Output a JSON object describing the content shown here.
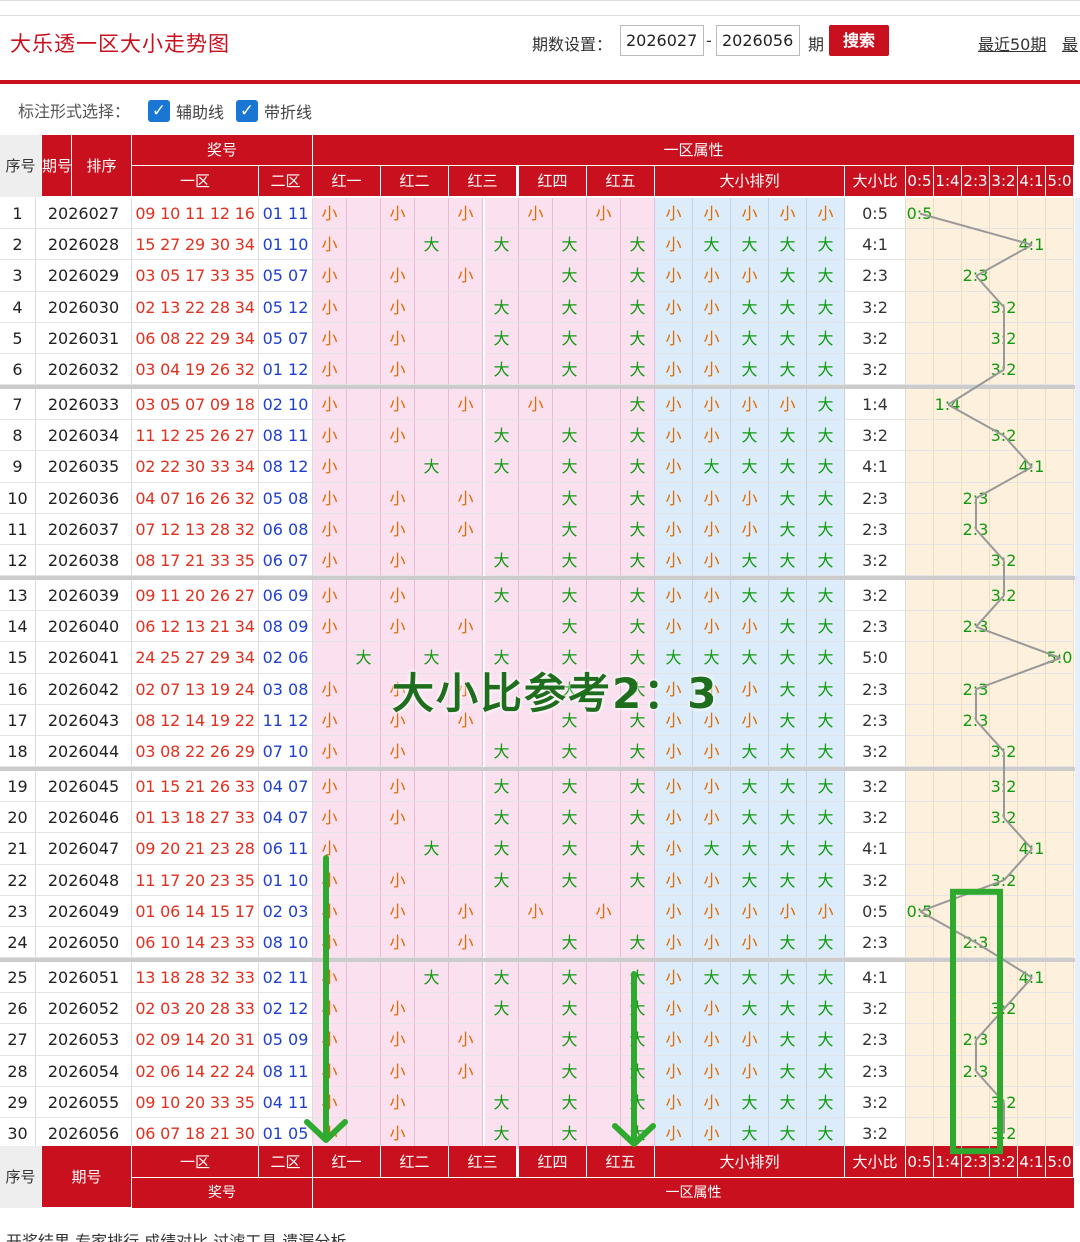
{
  "title": "大乐透一区大小走势图",
  "controls": {
    "label": "期数设置：",
    "start": "2026027",
    "sep": "-",
    "end": "2026056",
    "qi": "期",
    "search": "搜索",
    "recent50": "最近50期",
    "recent_more": "最"
  },
  "options": {
    "label": "标注形式选择：",
    "aux": "辅助线",
    "line": "带折线",
    "aux_checked": true,
    "line_checked": true
  },
  "headers": {
    "seq": "序号",
    "qihao": "期号",
    "sort": "排序",
    "jianghao": "奖号",
    "yiqu": "一区",
    "erqu": "二区",
    "attr": "一区属性",
    "reds": [
      "红一",
      "红二",
      "红三",
      "红四",
      "红五"
    ],
    "arr": "大小排列",
    "ratio": "大小比",
    "ratios": [
      "0:5",
      "1:4",
      "2:3",
      "3:2",
      "4:1",
      "5:0"
    ]
  },
  "rows": [
    {
      "n": "1",
      "q": "2026027",
      "red": "09 10 11 12 16",
      "blue": "01 11",
      "p": "SSSSS",
      "r": "0:5"
    },
    {
      "n": "2",
      "q": "2026028",
      "red": "15 27 29 30 34",
      "blue": "01 10",
      "p": "SBBBB",
      "r": "4:1"
    },
    {
      "n": "3",
      "q": "2026029",
      "red": "03 05 17 33 35",
      "blue": "05 07",
      "p": "SSSBB",
      "r": "2:3"
    },
    {
      "n": "4",
      "q": "2026030",
      "red": "02 13 22 28 34",
      "blue": "05 12",
      "p": "SSBBB",
      "r": "3:2"
    },
    {
      "n": "5",
      "q": "2026031",
      "red": "06 08 22 29 34",
      "blue": "05 07",
      "p": "SSBBB",
      "r": "3:2"
    },
    {
      "n": "6",
      "q": "2026032",
      "red": "03 04 19 26 32",
      "blue": "01 12",
      "p": "SSBBB",
      "r": "3:2"
    },
    {
      "n": "7",
      "q": "2026033",
      "red": "03 05 07 09 18",
      "blue": "02 10",
      "p": "SSSSB",
      "r": "1:4"
    },
    {
      "n": "8",
      "q": "2026034",
      "red": "11 12 25 26 27",
      "blue": "08 11",
      "p": "SSBBB",
      "r": "3:2"
    },
    {
      "n": "9",
      "q": "2026035",
      "red": "02 22 30 33 34",
      "blue": "08 12",
      "p": "SBBBB",
      "r": "4:1"
    },
    {
      "n": "10",
      "q": "2026036",
      "red": "04 07 16 26 32",
      "blue": "05 08",
      "p": "SSSBB",
      "r": "2:3"
    },
    {
      "n": "11",
      "q": "2026037",
      "red": "07 12 13 28 32",
      "blue": "06 08",
      "p": "SSSBB",
      "r": "2:3"
    },
    {
      "n": "12",
      "q": "2026038",
      "red": "08 17 21 33 35",
      "blue": "06 07",
      "p": "SSBBB",
      "r": "3:2"
    },
    {
      "n": "13",
      "q": "2026039",
      "red": "09 11 20 26 27",
      "blue": "06 09",
      "p": "SSBBB",
      "r": "3:2"
    },
    {
      "n": "14",
      "q": "2026040",
      "red": "06 12 13 21 34",
      "blue": "08 09",
      "p": "SSSBB",
      "r": "2:3"
    },
    {
      "n": "15",
      "q": "2026041",
      "red": "24 25 27 29 34",
      "blue": "02 06",
      "p": "BBBBB",
      "r": "5:0"
    },
    {
      "n": "16",
      "q": "2026042",
      "red": "02 07 13 19 24",
      "blue": "03 08",
      "p": "SSSBB",
      "r": "2:3"
    },
    {
      "n": "17",
      "q": "2026043",
      "red": "08 12 14 19 22",
      "blue": "11 12",
      "p": "SSSBB",
      "r": "2:3"
    },
    {
      "n": "18",
      "q": "2026044",
      "red": "03 08 22 26 29",
      "blue": "07 10",
      "p": "SSBBB",
      "r": "3:2"
    },
    {
      "n": "19",
      "q": "2026045",
      "red": "01 15 21 26 33",
      "blue": "04 07",
      "p": "SSBBB",
      "r": "3:2"
    },
    {
      "n": "20",
      "q": "2026046",
      "red": "01 13 18 27 33",
      "blue": "04 07",
      "p": "SSBBB",
      "r": "3:2"
    },
    {
      "n": "21",
      "q": "2026047",
      "red": "09 20 21 23 28",
      "blue": "06 11",
      "p": "SBBBB",
      "r": "4:1"
    },
    {
      "n": "22",
      "q": "2026048",
      "red": "11 17 20 23 35",
      "blue": "01 10",
      "p": "SSBBB",
      "r": "3:2"
    },
    {
      "n": "23",
      "q": "2026049",
      "red": "01 06 14 15 17",
      "blue": "02 03",
      "p": "SSSSS",
      "r": "0:5"
    },
    {
      "n": "24",
      "q": "2026050",
      "red": "06 10 14 23 33",
      "blue": "08 10",
      "p": "SSSBB",
      "r": "2:3"
    },
    {
      "n": "25",
      "q": "2026051",
      "red": "13 18 28 32 33",
      "blue": "02 11",
      "p": "SBBBB",
      "r": "4:1"
    },
    {
      "n": "26",
      "q": "2026052",
      "red": "02 03 20 28 33",
      "blue": "02 12",
      "p": "SSBBB",
      "r": "3:2"
    },
    {
      "n": "27",
      "q": "2026053",
      "red": "02 09 14 20 31",
      "blue": "05 09",
      "p": "SSSBB",
      "r": "2:3"
    },
    {
      "n": "28",
      "q": "2026054",
      "red": "02 06 14 22 24",
      "blue": "08 11",
      "p": "SSSBB",
      "r": "2:3"
    },
    {
      "n": "29",
      "q": "2026055",
      "red": "09 10 20 33 35",
      "blue": "04 11",
      "p": "SSBBB",
      "r": "3:2"
    },
    {
      "n": "30",
      "q": "2026056",
      "red": "06 07 18 21 30",
      "blue": "01 05",
      "p": "SSBBB",
      "r": "3:2"
    }
  ],
  "small": "小",
  "big": "大",
  "annotation": "大小比参考2：3",
  "footer": "开奖结果  专家排行  成绩对比  过滤工具  遗漏分析"
}
